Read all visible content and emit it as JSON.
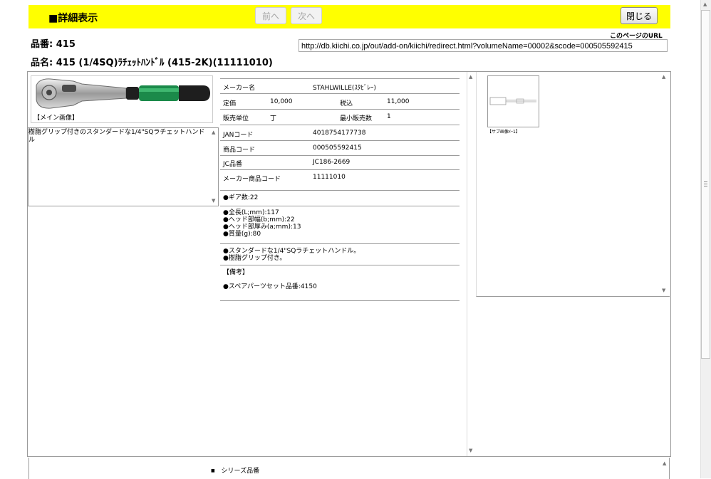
{
  "header": {
    "title": "■詳細表示",
    "prev_label": "前へ",
    "next_label": "次へ",
    "close_label": "閉じる",
    "bar_color": "#ffff00"
  },
  "product": {
    "part_no": "品番: 415",
    "part_name": "品名: 415 (1/4SQ)ﾗﾁｪｯﾄﾊﾝﾄﾞﾙ (415-2K)(11111010)"
  },
  "link": {
    "label": "このページのURL",
    "url": "http://db.kiichi.co.jp/out/add-on/kiichi/redirect.html?volumeName=00002&scode=000505592415"
  },
  "main_image": {
    "caption": "【メイン画像】",
    "icon": "ratchet-handle-icon"
  },
  "description": "樹脂グリップ付きのスタンダードな1/4\"SQラチェットハンドル",
  "info": {
    "maker_label": "メーカー名",
    "maker_value": "STAHLWILLE(ｽﾀﾋﾞﾚｰ)",
    "list_price_label": "定価",
    "list_price_value": "10,000",
    "tax_incl_label": "税込",
    "tax_incl_value": "11,000",
    "unit_label": "販売単位",
    "unit_value": "丁",
    "min_qty_label": "最小販売数",
    "min_qty_value": "1",
    "jan_label": "JANコード",
    "jan_value": "4018754177738",
    "product_code_label": "商品コード",
    "product_code_value": "000505592415",
    "jc_label": "JC品番",
    "jc_value": "JC186-2669",
    "maker_code_label": "メーカー商品コード",
    "maker_code_value": "11111010"
  },
  "specs": {
    "gear": "●ギア数:22",
    "dims": [
      "●全長(L;mm):117",
      "●ヘッド部幅(b;mm):22",
      "●ヘッド部厚み(a;mm):13",
      "●質量(g):80"
    ],
    "features": [
      "●スタンダードな1/4\"SQラチェットハンドル。",
      "●樹脂グリップ付き。"
    ],
    "notes_title": "【備考】",
    "notes": "●スペアパーツセット品番:4150"
  },
  "sub_image": {
    "caption": "【サブ画像ﾒｰ1】"
  },
  "bottom": {
    "series_label": "シリーズ品番"
  }
}
